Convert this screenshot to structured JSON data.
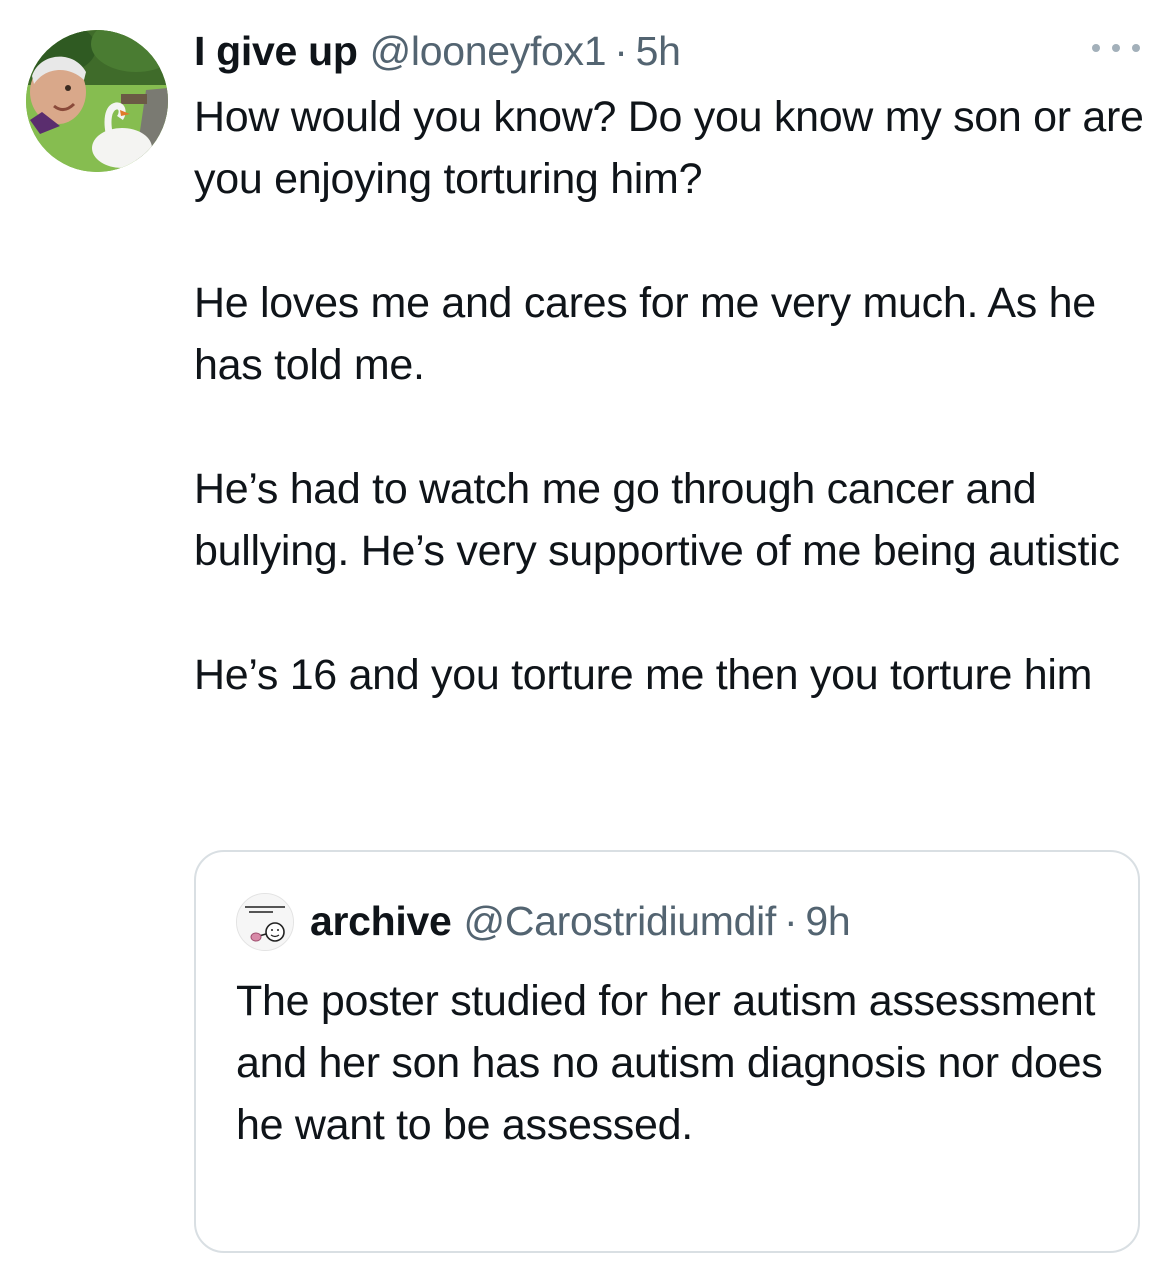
{
  "tweet": {
    "display_name": "I give up",
    "handle": "@looneyfox1",
    "separator": "·",
    "time": "5h",
    "paragraphs": [
      "How would you know?  Do you know my son or are you enjoying torturing him?",
      "He loves me and cares for me very much. As he has told me.",
      "He’s had to watch me go through cancer and bullying. He’s very supportive of me being autistic",
      "He’s 16 and you torture me then you torture him"
    ]
  },
  "quoted_tweet": {
    "display_name": "archive",
    "handle": "@Carostridiumdif",
    "separator": "·",
    "time": "9h",
    "text": "The poster studied for her autism assessment and her son has no autism diagnosis nor does he want to be assessed."
  },
  "icons": {
    "more": "more-horizontal-icon"
  },
  "colors": {
    "text_primary": "#0f1419",
    "text_secondary": "#536471",
    "border": "#d9dfe3",
    "dots": "#a3b0ba"
  }
}
